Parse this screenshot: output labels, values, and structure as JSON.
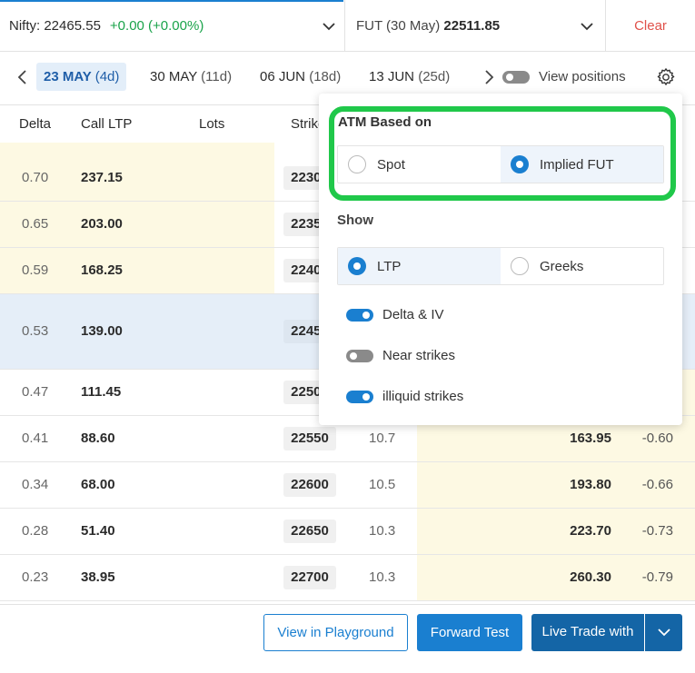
{
  "header": {
    "nifty_label": "Nifty:",
    "nifty_value": "22465.55",
    "nifty_change": "+0.00 (+0.00%)",
    "fut_label": "FUT (30 May)",
    "fut_value": "22511.85",
    "clear_label": "Clear"
  },
  "expiries": [
    {
      "date": "23 MAY",
      "days": "(4d)"
    },
    {
      "date": "30 MAY",
      "days": "(11d)"
    },
    {
      "date": "06 JUN",
      "days": "(18d)"
    },
    {
      "date": "13 JUN",
      "days": "(25d)"
    }
  ],
  "view_positions_label": "View positions",
  "table": {
    "headers": {
      "delta": "Delta",
      "call_ltp": "Call LTP",
      "lots": "Lots",
      "strike": "Strike"
    },
    "rows": [
      {
        "delta": "0.70",
        "call_ltp": "237.15",
        "strike": "22300",
        "iv": "",
        "put_ltp": "",
        "put_delta": ""
      },
      {
        "delta": "0.65",
        "call_ltp": "203.00",
        "strike": "22350",
        "iv": "",
        "put_ltp": "",
        "put_delta": ""
      },
      {
        "delta": "0.59",
        "call_ltp": "168.25",
        "strike": "22400",
        "iv": "",
        "put_ltp": "",
        "put_delta": ""
      },
      {
        "delta": "0.53",
        "call_ltp": "139.00",
        "strike": "22450",
        "iv": "",
        "put_ltp": "",
        "put_delta": ""
      },
      {
        "delta": "0.47",
        "call_ltp": "111.45",
        "strike": "22500",
        "iv": "",
        "put_ltp": "",
        "put_delta": ""
      },
      {
        "delta": "0.41",
        "call_ltp": "88.60",
        "strike": "22550",
        "iv": "10.7",
        "put_ltp": "163.95",
        "put_delta": "-0.60"
      },
      {
        "delta": "0.34",
        "call_ltp": "68.00",
        "strike": "22600",
        "iv": "10.5",
        "put_ltp": "193.80",
        "put_delta": "-0.66"
      },
      {
        "delta": "0.28",
        "call_ltp": "51.40",
        "strike": "22650",
        "iv": "10.3",
        "put_ltp": "223.70",
        "put_delta": "-0.73"
      },
      {
        "delta": "0.23",
        "call_ltp": "38.95",
        "strike": "22700",
        "iv": "10.3",
        "put_ltp": "260.30",
        "put_delta": "-0.79"
      }
    ]
  },
  "popup": {
    "atm_title": "ATM Based on",
    "atm_options": [
      "Spot",
      "Implied FUT"
    ],
    "atm_selected": "Implied FUT",
    "show_title": "Show",
    "show_options": [
      "LTP",
      "Greeks"
    ],
    "show_selected": "LTP",
    "toggles": [
      {
        "label": "Delta & IV",
        "on": true
      },
      {
        "label": "Near strikes",
        "on": false
      },
      {
        "label": "illiquid strikes",
        "on": true
      }
    ]
  },
  "footer": {
    "playground_label": "View in Playground",
    "forward_label": "Forward Test",
    "live_label": "Live Trade with"
  },
  "colors": {
    "accent": "#1a7fd0",
    "highlight": "#20c84a",
    "danger": "#e0514a",
    "positive": "#1aa34a"
  }
}
